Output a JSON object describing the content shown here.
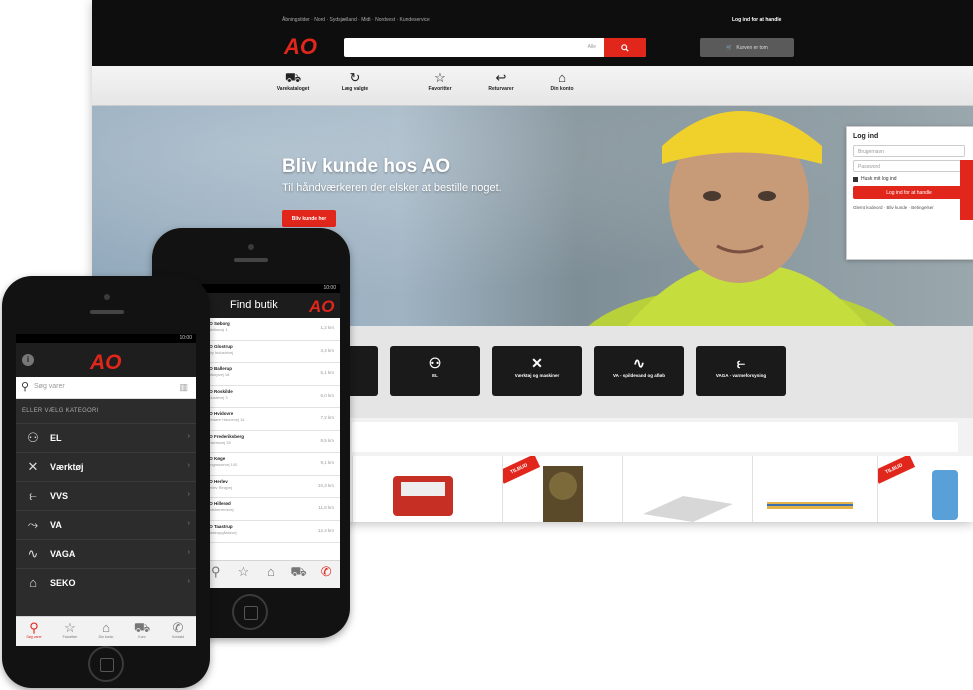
{
  "colors": {
    "brand_red": "#e1261c",
    "header_dark": "#0e0e0e"
  },
  "desktop": {
    "util_text": "Åbningstider · Nord · Sydsjælland · Midt · Nordvest · Kundeservice",
    "login_top": "Log ind for at handle",
    "logo": "AO",
    "search_select": "Alle",
    "search_icon": "search-icon",
    "cart_label": "Kurven er tom",
    "nav": [
      {
        "icon": "cart-icon",
        "label": "Varekataloget"
      },
      {
        "icon": "refresh-icon",
        "label": "Læg valgte"
      },
      {
        "icon": "star-icon",
        "label": "Favoritter"
      },
      {
        "icon": "return-icon",
        "label": "Returvarer"
      },
      {
        "icon": "user-icon",
        "label": "Din konto"
      }
    ],
    "hero": {
      "title": "Bliv kunde hos AO",
      "subtitle": "Til håndværkeren der elsker at bestille noget.",
      "button": "Bliv kunde her"
    },
    "login": {
      "title": "Log ind",
      "username_placeholder": "Brugernavn",
      "password_placeholder": "Password",
      "remember": "Husk mit log ind",
      "button": "Log ind for at handle",
      "links": "Glemt kodeord · Bliv kunde · Betingelser"
    },
    "categories": [
      {
        "icon": "bolt-icon",
        "label": ""
      },
      {
        "icon": "plug-icon",
        "label": "EL"
      },
      {
        "icon": "tools-icon",
        "label": "Værktøj og maskiner"
      },
      {
        "icon": "pipe-icon",
        "label": "VA - spildevand og afløb"
      },
      {
        "icon": "faucet-icon",
        "label": "VAGA - varmeforsyning"
      }
    ],
    "tilbud": "TILBUD"
  },
  "find_store": {
    "status": "10:00",
    "title": "Find butik",
    "logo": "AO",
    "stores": [
      {
        "name": "AO Søborg",
        "addr": "Fabriksvej 1",
        "dist": "1,2 km"
      },
      {
        "name": "AO Glostrup",
        "addr": "Ejby Industrivej",
        "dist": "3,4 km"
      },
      {
        "name": "AO Ballerup",
        "addr": "Baltorpvej 18",
        "dist": "5,1 km"
      },
      {
        "name": "AO Roskilde",
        "addr": "Industrivej 3",
        "dist": "6,0 km"
      },
      {
        "name": "AO Hvidovre",
        "addr": "Avedøre Havnevej 14",
        "dist": "7,2 km"
      },
      {
        "name": "AO Frederiksberg",
        "addr": "Finsensvej 28",
        "dist": "8,5 km"
      },
      {
        "name": "AO Køge",
        "addr": "Tangmosevej 100",
        "dist": "9,1 km"
      },
      {
        "name": "AO Herlev",
        "addr": "Herlev Ringvej",
        "dist": "10,3 km"
      },
      {
        "name": "AO Hillerød",
        "addr": "Slotsherrensvej",
        "dist": "11,8 km"
      },
      {
        "name": "AO Taastrup",
        "addr": "Taastrupgårdsvej",
        "dist": "12,4 km"
      }
    ],
    "tabs": [
      {
        "icon": "search-icon",
        "label": ""
      },
      {
        "icon": "star-icon",
        "label": ""
      },
      {
        "icon": "user-icon",
        "label": ""
      },
      {
        "icon": "cart-icon",
        "label": ""
      },
      {
        "icon": "phone-icon",
        "label": ""
      }
    ]
  },
  "catalog": {
    "status": "10:00",
    "logo": "AO",
    "search_placeholder": "Søg varer",
    "category_heading": "ELLER VÆLG KATEGORI",
    "categories": [
      {
        "icon": "plug-icon",
        "label": "EL"
      },
      {
        "icon": "tools-icon",
        "label": "Værktøj"
      },
      {
        "icon": "faucet-icon",
        "label": "VVS"
      },
      {
        "icon": "pipe-icon",
        "label": "VA"
      },
      {
        "icon": "wave-icon",
        "label": "VAGA"
      },
      {
        "icon": "house-icon",
        "label": "SEKO"
      }
    ],
    "tabs": [
      {
        "icon": "search-icon",
        "label": "Søg varer"
      },
      {
        "icon": "star-icon",
        "label": "Favoritter"
      },
      {
        "icon": "user-icon",
        "label": "Din konto"
      },
      {
        "icon": "cart-icon",
        "label": "Kurv"
      },
      {
        "icon": "phone-icon",
        "label": "Kontakt"
      }
    ]
  }
}
